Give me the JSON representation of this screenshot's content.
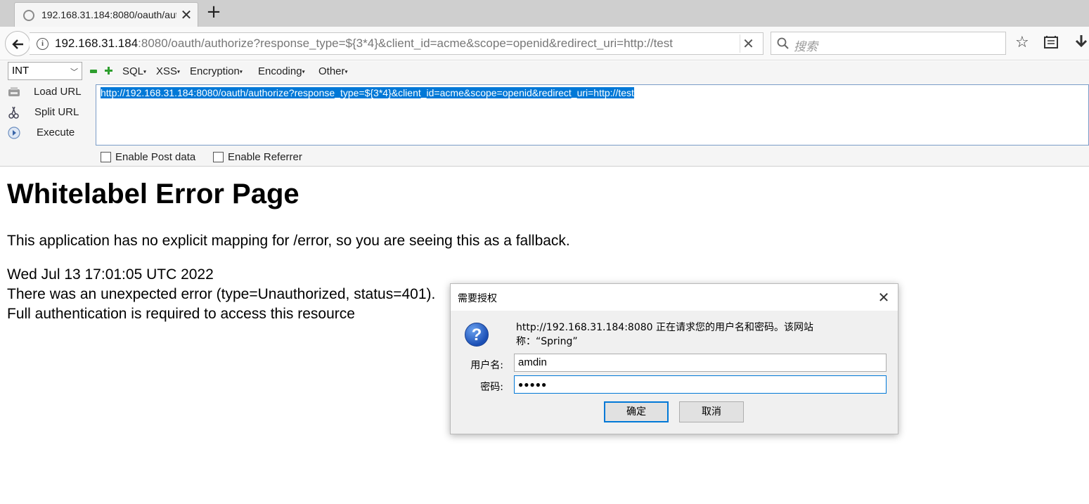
{
  "browser": {
    "tab_title": "192.168.31.184:8080/oauth/authorize?r",
    "url_host": "192.168.31.184",
    "url_rest": ":8080/oauth/authorize?response_type=${3*4}&client_id=acme&scope=openid&redirect_uri=http://test",
    "search_placeholder": "搜索"
  },
  "hackbar": {
    "select_value": "INT",
    "menus": [
      "SQL",
      "XSS",
      "Encryption",
      "Encoding",
      "Other"
    ],
    "load_url": "Load URL",
    "split_url": "Split URL",
    "execute": "Execute",
    "url_text": "http://192.168.31.184:8080/oauth/authorize?response_type=${3*4}&client_id=acme&scope=openid&redirect_uri=http://test",
    "enable_post": "Enable Post data",
    "enable_referrer": "Enable Referrer"
  },
  "page": {
    "title": "Whitelabel Error Page",
    "line1": "This application has no explicit mapping for /error, so you are seeing this as a fallback.",
    "line2": "Wed Jul 13 17:01:05 UTC 2022",
    "line3": "There was an unexpected error (type=Unauthorized, status=401).",
    "line4": "Full authentication is required to access this resource"
  },
  "dialog": {
    "title": "需要授权",
    "message": "http://192.168.31.184:8080 正在请求您的用户名和密码。该网站称：“Spring”",
    "username_label": "用户名:",
    "username_value": "amdin",
    "password_label": "密码:",
    "password_value": "●●●●●",
    "ok_label": "确定",
    "cancel_label": "取消"
  },
  "colors": {
    "selection": "#0078d7",
    "hackbar_green": "#2e9e2e"
  }
}
